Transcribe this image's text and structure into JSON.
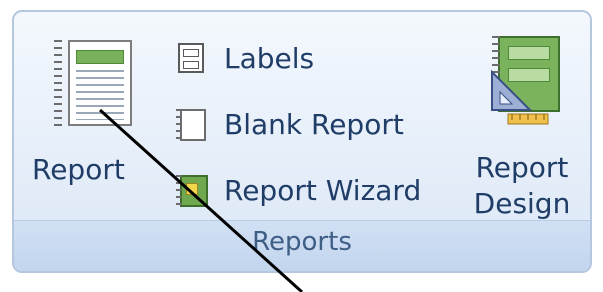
{
  "ribbon_group": {
    "name": "Reports",
    "buttons": {
      "report": "Report",
      "labels": "Labels",
      "blank_report": "Blank Report",
      "report_wizard": "Report Wizard",
      "report_design_line1": "Report",
      "report_design_line2": "Design"
    }
  },
  "icons": {
    "report": "report-icon",
    "labels": "labels-icon",
    "blank_report": "blank-report-icon",
    "report_wizard": "report-wizard-icon",
    "report_design": "report-design-icon"
  },
  "colors": {
    "text": "#1f3d66",
    "group_label": "#3f5e86",
    "panel_border": "#b5c7df",
    "icon_green": "#6fa84f"
  }
}
